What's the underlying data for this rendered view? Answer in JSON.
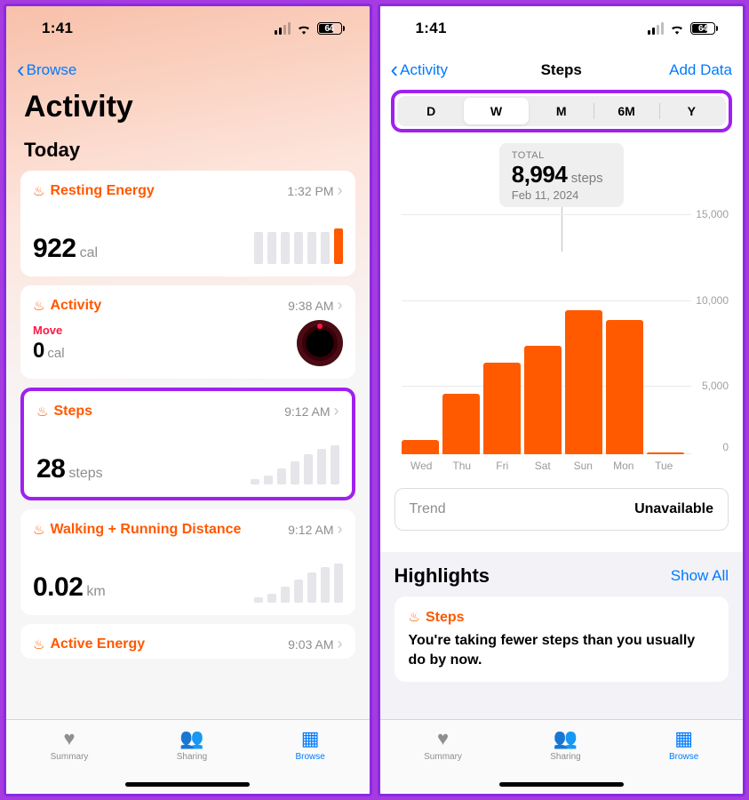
{
  "status": {
    "time": "1:41",
    "battery": "64"
  },
  "left": {
    "back": "Browse",
    "title": "Activity",
    "section": "Today",
    "cards": {
      "resting": {
        "name": "Resting Energy",
        "time": "1:32 PM",
        "value": "922",
        "unit": "cal"
      },
      "activity": {
        "name": "Activity",
        "time": "9:38 AM",
        "move_label": "Move",
        "move_value": "0",
        "move_unit": "cal"
      },
      "steps": {
        "name": "Steps",
        "time": "9:12 AM",
        "value": "28",
        "unit": "steps"
      },
      "walk": {
        "name": "Walking + Running Distance",
        "time": "9:12 AM",
        "value": "0.02",
        "unit": "km"
      },
      "active": {
        "name": "Active Energy",
        "time": "9:03 AM"
      }
    }
  },
  "right": {
    "back": "Activity",
    "title": "Steps",
    "action": "Add Data",
    "segments": [
      "D",
      "W",
      "M",
      "6M",
      "Y"
    ],
    "selected_segment": "W",
    "tooltip": {
      "label": "TOTAL",
      "value": "8,994",
      "unit": "steps",
      "date": "Feb 11, 2024"
    },
    "y_ticks": [
      "15,000",
      "10,000",
      "5,000",
      "0"
    ],
    "trend": {
      "label": "Trend",
      "value": "Unavailable"
    },
    "highlights": {
      "title": "Highlights",
      "link": "Show All",
      "card_name": "Steps",
      "card_text": "You're taking fewer steps than you usually do by now."
    }
  },
  "tabs": {
    "summary": "Summary",
    "sharing": "Sharing",
    "browse": "Browse"
  },
  "chart_data": {
    "type": "bar",
    "title": "Steps — Weekly Total",
    "xlabel": "",
    "ylabel": "Steps",
    "ylim": [
      0,
      15000
    ],
    "categories": [
      "Wed",
      "Thu",
      "Fri",
      "Sat",
      "Sun",
      "Mon",
      "Tue"
    ],
    "values": [
      900,
      3800,
      5700,
      6800,
      8994,
      8400,
      100
    ],
    "total": 8994,
    "total_date": "Feb 11, 2024"
  }
}
